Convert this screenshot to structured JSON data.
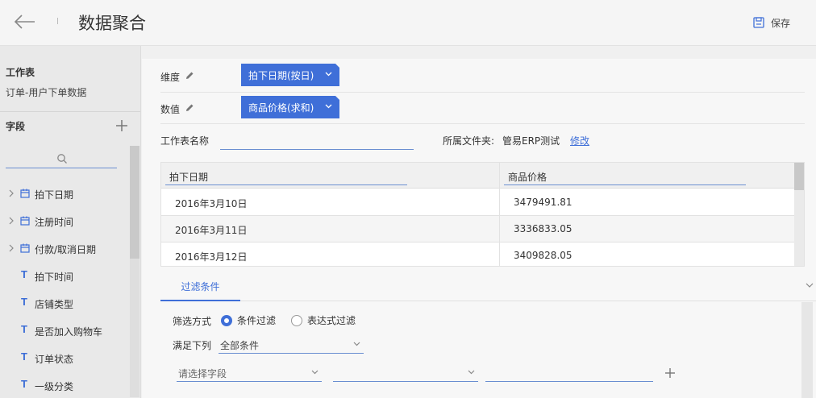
{
  "header": {
    "title": "数据聚合",
    "save_label": "保存"
  },
  "sidebar": {
    "worksheet_title": "工作表",
    "worksheet_name": "订单-用户下单数据",
    "fields_title": "字段",
    "fields": [
      {
        "type": "date",
        "label": "拍下日期",
        "expandable": true
      },
      {
        "type": "date",
        "label": "注册时间",
        "expandable": true
      },
      {
        "type": "date",
        "label": "付款/取消日期",
        "expandable": true
      },
      {
        "type": "text",
        "label": "拍下时间",
        "expandable": false
      },
      {
        "type": "text",
        "label": "店铺类型",
        "expandable": false
      },
      {
        "type": "text",
        "label": "是否加入购物车",
        "expandable": false
      },
      {
        "type": "text",
        "label": "订单状态",
        "expandable": false
      },
      {
        "type": "text",
        "label": "一级分类",
        "expandable": false
      }
    ]
  },
  "config": {
    "dimension_label": "维度",
    "dimension_chip": "拍下日期(按日)",
    "value_label": "数值",
    "value_chip": "商品价格(求和)",
    "ws_name_label": "工作表名称",
    "ws_name_value": "",
    "folder_label": "所属文件夹:",
    "folder_name": "管易ERP测试",
    "folder_edit": "修改"
  },
  "table": {
    "headers": [
      "拍下日期",
      "商品价格"
    ],
    "rows": [
      [
        "2016年3月10日",
        "3479491.81"
      ],
      [
        "2016年3月11日",
        "3336833.05"
      ],
      [
        "2016年3月12日",
        "3409828.05"
      ]
    ]
  },
  "filter": {
    "tab_label": "过滤条件",
    "method_label": "筛选方式",
    "option_condition": "条件过滤",
    "option_expression": "表达式过滤",
    "selected": "condition",
    "satisfy_label": "满足下列",
    "satisfy_value": "全部条件",
    "field_placeholder": "请选择字段",
    "operator_value": "",
    "value_placeholder": ""
  },
  "colors": {
    "accent": "#3f6fd8",
    "underline": "#6a8ed1"
  }
}
